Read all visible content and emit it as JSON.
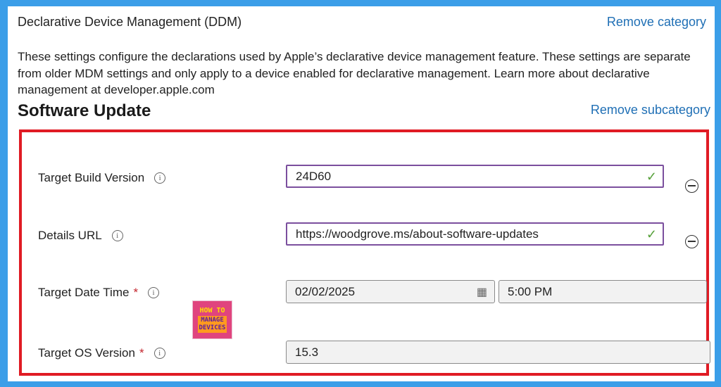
{
  "category": {
    "title": "Declarative Device Management (DDM)",
    "remove_label": "Remove category",
    "description": "These settings configure the declarations used by Apple’s declarative device management feature. These settings are separate from older MDM settings and only apply to a device enabled for declarative management. Learn more about declarative management at developer.apple.com"
  },
  "subcategory": {
    "title": "Software Update",
    "remove_label": "Remove subcategory"
  },
  "fields": {
    "target_build_version": {
      "label": "Target Build Version",
      "value": "24D60"
    },
    "details_url": {
      "label": "Details URL",
      "value": "https://woodgrove.ms/about-software-updates"
    },
    "target_date_time": {
      "label": "Target Date Time",
      "required_mark": "*",
      "date": "02/02/2025",
      "time": "5:00 PM"
    },
    "target_os_version": {
      "label": "Target OS Version",
      "required_mark": "*",
      "value": "15.3"
    }
  },
  "info_icon_glyph": "i",
  "logo": {
    "line1": "HOW TO",
    "line2": "MANAGE",
    "line3": "DEVICES"
  },
  "colors": {
    "accent_link": "#1f6fb5",
    "highlight_box": "#e01b24",
    "active_border": "#7b4f9e",
    "check": "#56a03a",
    "background": "#3b9ee8"
  }
}
